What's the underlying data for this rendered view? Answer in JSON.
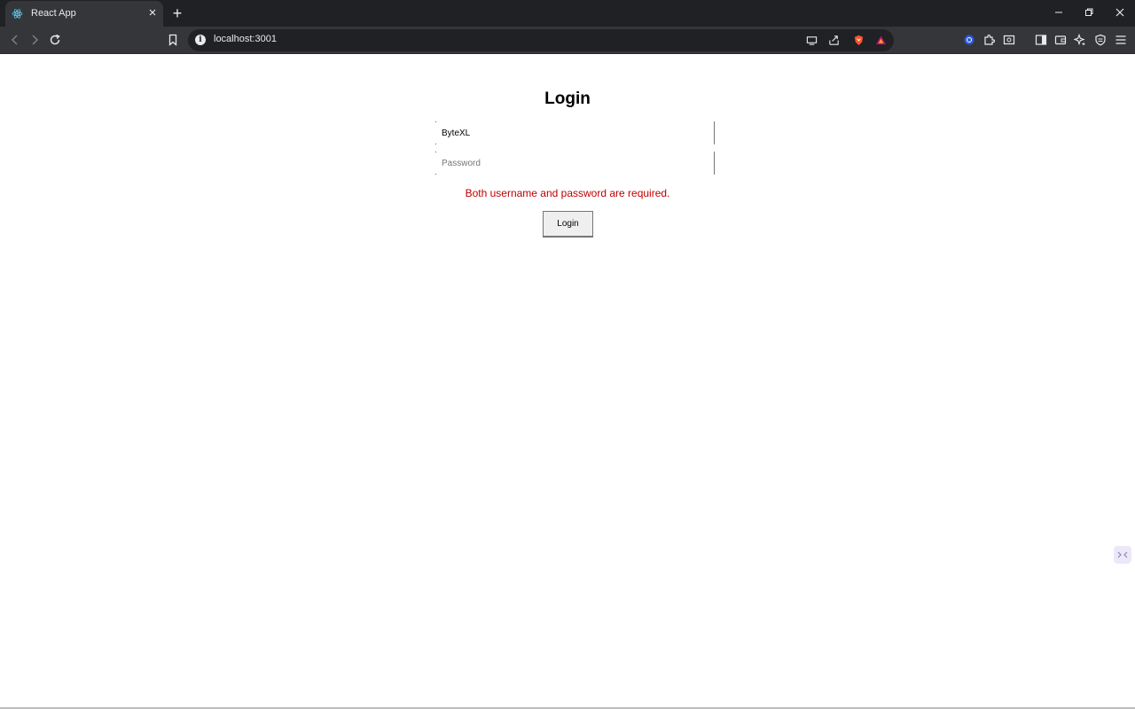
{
  "browser": {
    "tab": {
      "title": "React App",
      "favicon": "react-logo-icon"
    },
    "url": "localhost:3001",
    "icons": {
      "back": "back-arrow-icon",
      "forward": "forward-arrow-icon",
      "reload": "reload-icon",
      "bookmark": "bookmark-icon",
      "site_info": "info-icon",
      "cast": "cast-icon",
      "share": "share-icon",
      "shields": "brave-shields-icon",
      "rewards": "brave-rewards-icon",
      "extension1": "extension-badge-icon",
      "extensions": "puzzle-piece-icon",
      "media": "media-icon",
      "sidebar": "sidebar-icon",
      "wallet": "wallet-icon",
      "leo": "sparkle-icon",
      "vpn": "vpn-shield-icon",
      "menu": "hamburger-menu-icon"
    },
    "colors": {
      "tabbar_bg": "#202124",
      "toolbar_bg": "#35363a"
    }
  },
  "login": {
    "title": "Login",
    "username_value": "ByteXL",
    "password_placeholder": "Password",
    "error": "Both username and password are required.",
    "button_label": "Login",
    "colors": {
      "error": "#c00000",
      "button_bg": "#efefef"
    }
  }
}
